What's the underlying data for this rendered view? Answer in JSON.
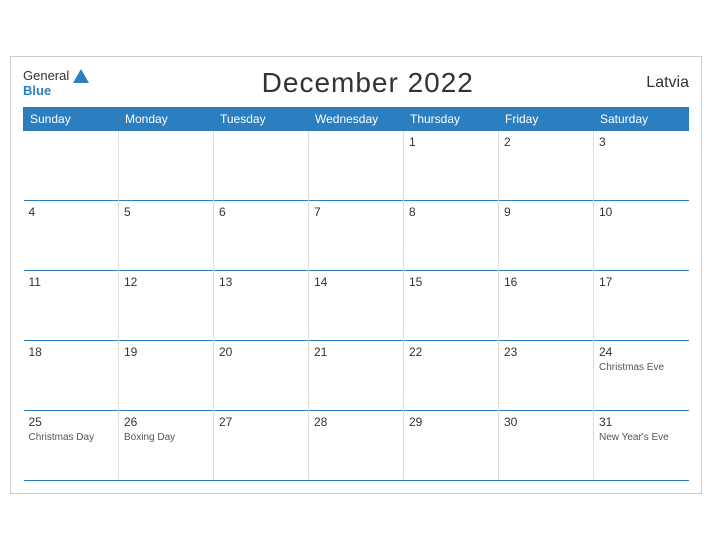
{
  "header": {
    "logo_general": "General",
    "logo_blue": "Blue",
    "title": "December 2022",
    "country": "Latvia"
  },
  "days_of_week": [
    "Sunday",
    "Monday",
    "Tuesday",
    "Wednesday",
    "Thursday",
    "Friday",
    "Saturday"
  ],
  "weeks": [
    [
      {
        "number": "",
        "holiday": "",
        "empty": true
      },
      {
        "number": "",
        "holiday": "",
        "empty": true
      },
      {
        "number": "",
        "holiday": "",
        "empty": true
      },
      {
        "number": "",
        "holiday": "",
        "empty": true
      },
      {
        "number": "1",
        "holiday": ""
      },
      {
        "number": "2",
        "holiday": ""
      },
      {
        "number": "3",
        "holiday": ""
      }
    ],
    [
      {
        "number": "4",
        "holiday": ""
      },
      {
        "number": "5",
        "holiday": ""
      },
      {
        "number": "6",
        "holiday": ""
      },
      {
        "number": "7",
        "holiday": ""
      },
      {
        "number": "8",
        "holiday": ""
      },
      {
        "number": "9",
        "holiday": ""
      },
      {
        "number": "10",
        "holiday": ""
      }
    ],
    [
      {
        "number": "11",
        "holiday": ""
      },
      {
        "number": "12",
        "holiday": ""
      },
      {
        "number": "13",
        "holiday": ""
      },
      {
        "number": "14",
        "holiday": ""
      },
      {
        "number": "15",
        "holiday": ""
      },
      {
        "number": "16",
        "holiday": ""
      },
      {
        "number": "17",
        "holiday": ""
      }
    ],
    [
      {
        "number": "18",
        "holiday": ""
      },
      {
        "number": "19",
        "holiday": ""
      },
      {
        "number": "20",
        "holiday": ""
      },
      {
        "number": "21",
        "holiday": ""
      },
      {
        "number": "22",
        "holiday": ""
      },
      {
        "number": "23",
        "holiday": ""
      },
      {
        "number": "24",
        "holiday": "Christmas Eve"
      }
    ],
    [
      {
        "number": "25",
        "holiday": "Christmas Day"
      },
      {
        "number": "26",
        "holiday": "Boxing Day"
      },
      {
        "number": "27",
        "holiday": ""
      },
      {
        "number": "28",
        "holiday": ""
      },
      {
        "number": "29",
        "holiday": ""
      },
      {
        "number": "30",
        "holiday": ""
      },
      {
        "number": "31",
        "holiday": "New Year's Eve"
      }
    ]
  ]
}
